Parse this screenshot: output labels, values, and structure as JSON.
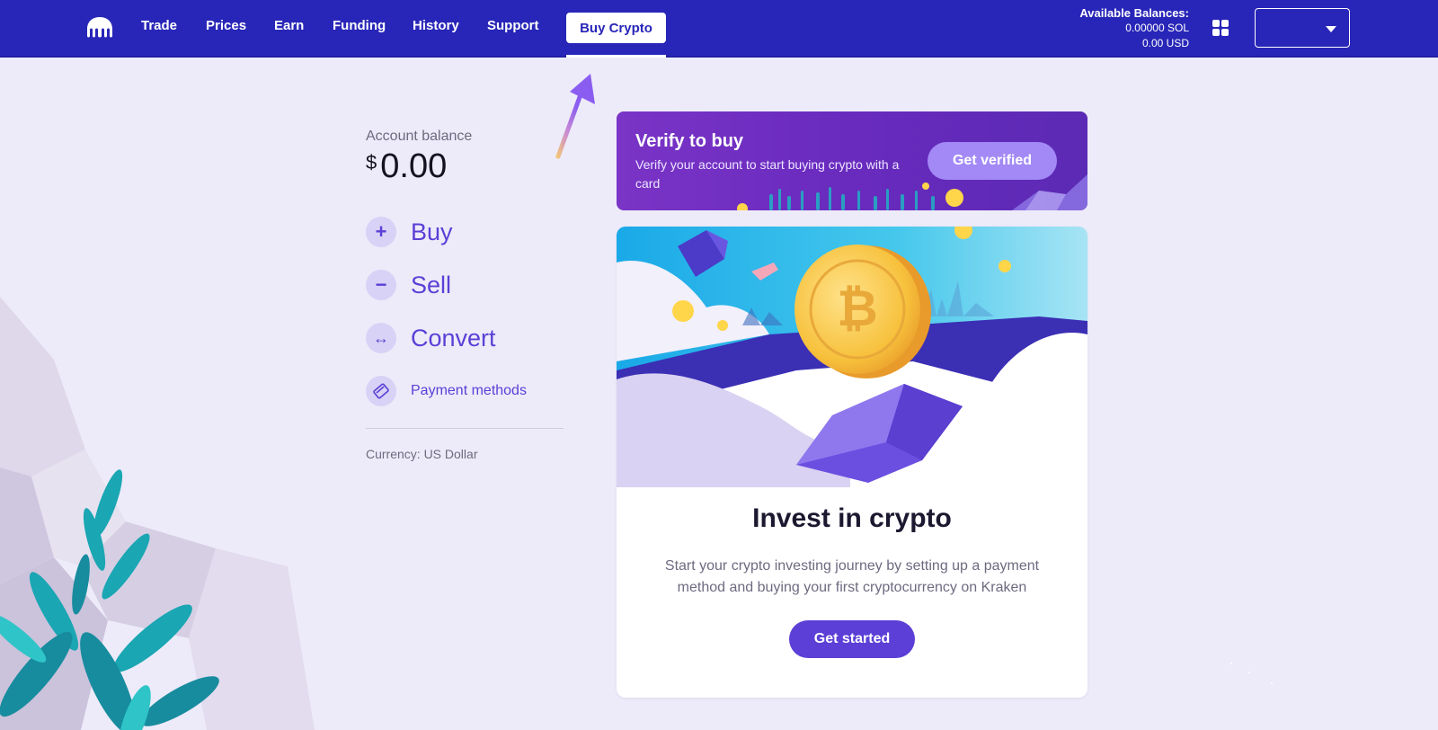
{
  "nav": {
    "items": [
      "Trade",
      "Prices",
      "Earn",
      "Funding",
      "History",
      "Support"
    ],
    "active_label": "Buy Crypto"
  },
  "balances": {
    "heading": "Available Balances:",
    "sol": "0.00000 SOL",
    "usd": "0.00 USD"
  },
  "account": {
    "balance_label": "Account balance",
    "currency_symbol": "$",
    "balance_value": "0.00",
    "actions": [
      {
        "label": "Buy",
        "icon": "plus-icon"
      },
      {
        "label": "Sell",
        "icon": "minus-icon"
      },
      {
        "label": "Convert",
        "icon": "swap-arrows-icon"
      },
      {
        "label": "Payment methods",
        "icon": "card-icon"
      }
    ],
    "currency_text": "Currency: US Dollar"
  },
  "verify": {
    "title": "Verify to buy",
    "text": "Verify your account to start buying crypto with a card",
    "button": "Get verified"
  },
  "invest": {
    "title": "Invest in crypto",
    "text": "Start your crypto investing journey by setting up a payment method and buying your first cryptocurrency on Kraken",
    "button": "Get started"
  },
  "colors": {
    "nav_bg": "#2826b8",
    "page_bg": "#edebf9",
    "accent": "#5b3fd6",
    "verify_bg": "#6a2bbf",
    "verify_button": "#a389f5"
  }
}
